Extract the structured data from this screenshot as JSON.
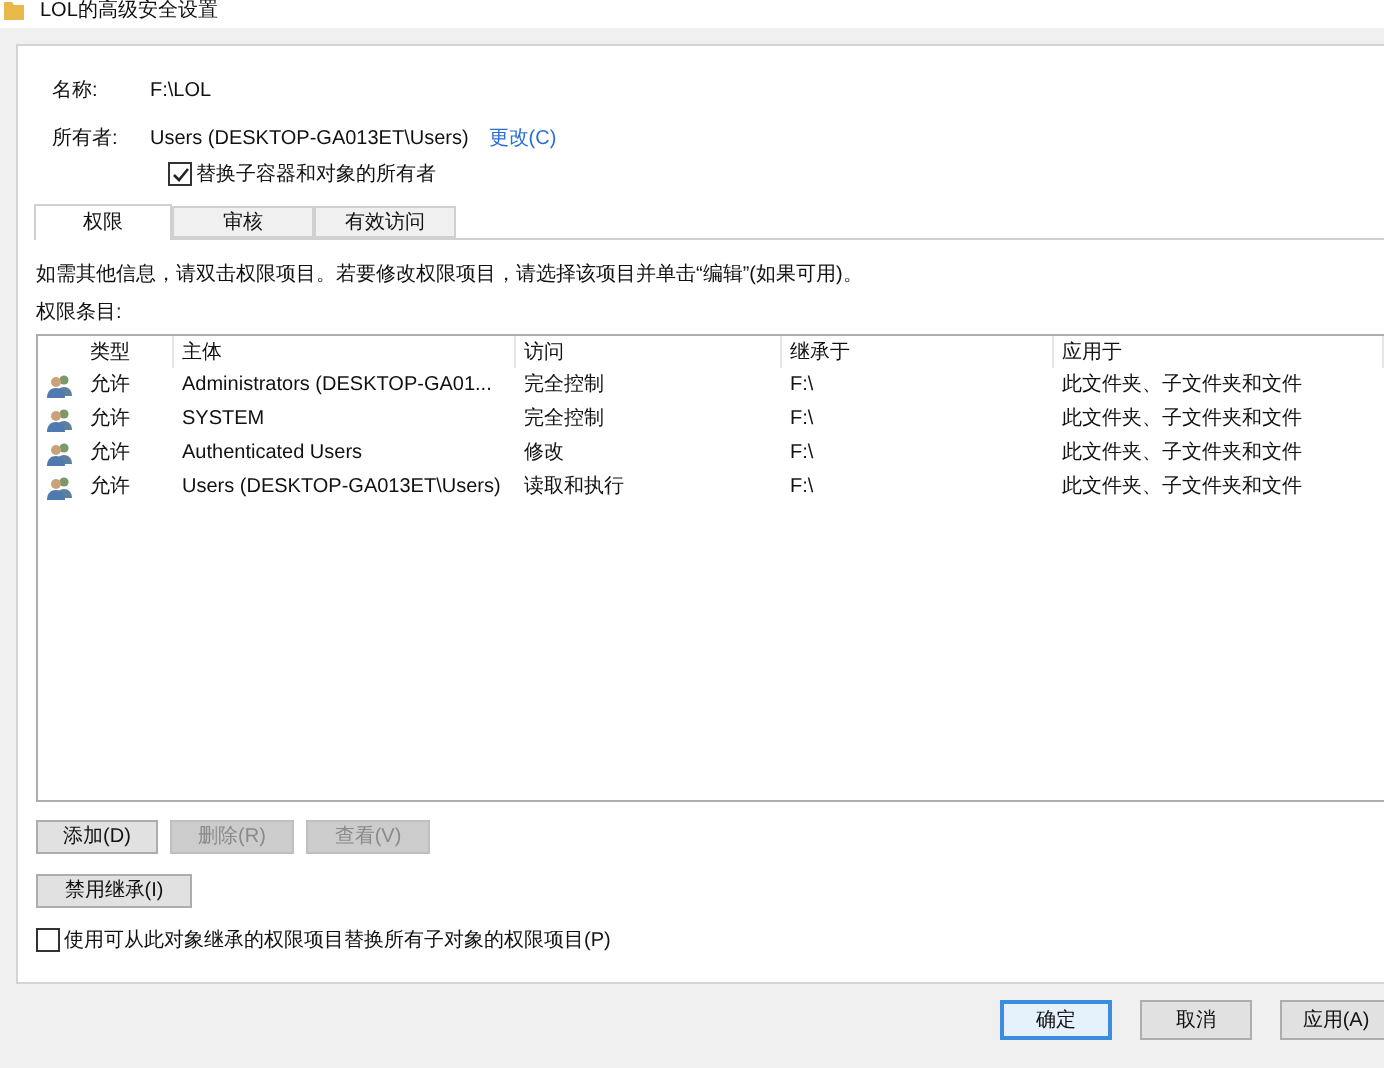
{
  "window": {
    "title": "LOL的高级安全设置"
  },
  "name": {
    "label": "名称:",
    "value": "F:\\LOL"
  },
  "owner": {
    "label": "所有者:",
    "value": "Users (DESKTOP-GA013ET\\Users)",
    "link": "更改(C)"
  },
  "replace_owner": {
    "label": "替换子容器和对象的所有者",
    "checked": true
  },
  "tabs": [
    {
      "label": "权限",
      "selected": true
    },
    {
      "label": "审核",
      "selected": false
    },
    {
      "label": "有效访问",
      "selected": false
    }
  ],
  "info": "如需其他信息，请双击权限项目。若要修改权限项目，请选择该项目并单击“编辑”(如果可用)。",
  "list_label": "权限条目:",
  "table": {
    "columns": [
      "类型",
      "主体",
      "访问",
      "继承于",
      "应用于"
    ],
    "rows": [
      {
        "cells": [
          "允许",
          "Administrators (DESKTOP-GA01...",
          "完全控制",
          "F:\\",
          "此文件夹、子文件夹和文件"
        ]
      },
      {
        "cells": [
          "允许",
          "SYSTEM",
          "完全控制",
          "F:\\",
          "此文件夹、子文件夹和文件"
        ]
      },
      {
        "cells": [
          "允许",
          "Authenticated Users",
          "修改",
          "F:\\",
          "此文件夹、子文件夹和文件"
        ]
      },
      {
        "cells": [
          "允许",
          "Users (DESKTOP-GA013ET\\Users)",
          "读取和执行",
          "F:\\",
          "此文件夹、子文件夹和文件"
        ]
      }
    ]
  },
  "list_buttons": [
    {
      "label": "添加(D)",
      "disabled": false
    },
    {
      "label": "删除(R)",
      "disabled": true
    },
    {
      "label": "查看(V)",
      "disabled": true
    }
  ],
  "inherit_button": {
    "label": "禁用继承(I)"
  },
  "replace_children": {
    "label": "使用可从此对象继承的权限项目替换所有子对象的权限项目(P)",
    "checked": false
  },
  "dialog_buttons": [
    {
      "label": "确定",
      "focused": true
    },
    {
      "label": "取消",
      "focused": false
    },
    {
      "label": "应用(A)",
      "focused": false
    }
  ]
}
